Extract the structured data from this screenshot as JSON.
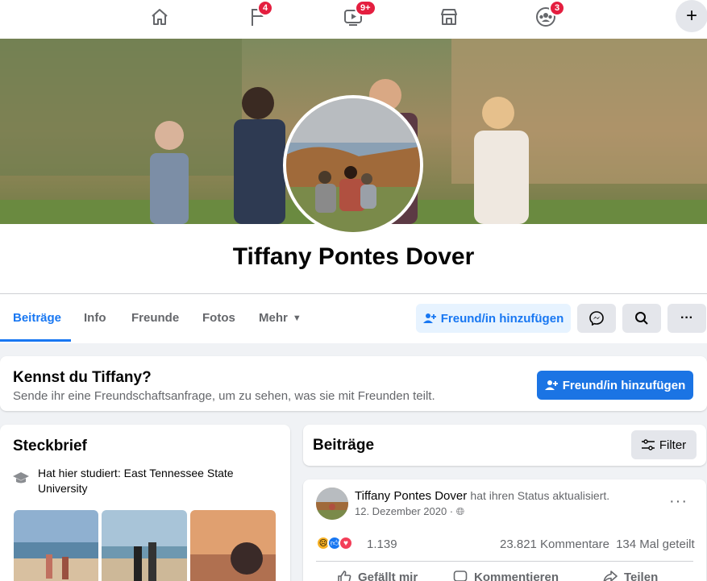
{
  "topnav": {
    "icons": [
      "home-icon",
      "flag-icon",
      "video-icon",
      "marketplace-icon",
      "groups-icon",
      "plus-icon"
    ],
    "flag_badge": "4",
    "video_badge": "9+",
    "groups_badge": "3",
    "plus_label": "+"
  },
  "profile": {
    "name": "Tiffany Pontes Dover"
  },
  "tabs": {
    "posts": "Beiträge",
    "info": "Info",
    "friends": "Freunde",
    "photos": "Fotos",
    "more": "Mehr"
  },
  "actions": {
    "add_friend": "Freund/in hinzufügen",
    "messenger_icon": "messenger-icon",
    "search_icon": "search-icon",
    "more_label": "···"
  },
  "know_card": {
    "title": "Kennst du Tiffany?",
    "subtitle": "Sende ihr eine Freundschaftsanfrage, um zu sehen, was sie mit Freunden teilt.",
    "button": "Freund/in hinzufügen"
  },
  "intro": {
    "title": "Steckbrief",
    "studied": "Hat hier studiert: East Tennessee State University"
  },
  "posts_section": {
    "title": "Beiträge",
    "filter": "Filter"
  },
  "post": {
    "author": "Tiffany Pontes Dover",
    "action_text": "hat ihren Status aktualisiert.",
    "date": "12. Dezember 2020 · ",
    "reaction_count": "1.139",
    "comments": "23.821 Kommentare",
    "shares": "134 Mal geteilt",
    "like": "Gefällt mir",
    "comment": "Kommentieren",
    "share": "Teilen",
    "more": "···"
  },
  "colors": {
    "accent": "#1877f2",
    "badge": "#e41e3f",
    "button_blue": "#1b74e4"
  }
}
